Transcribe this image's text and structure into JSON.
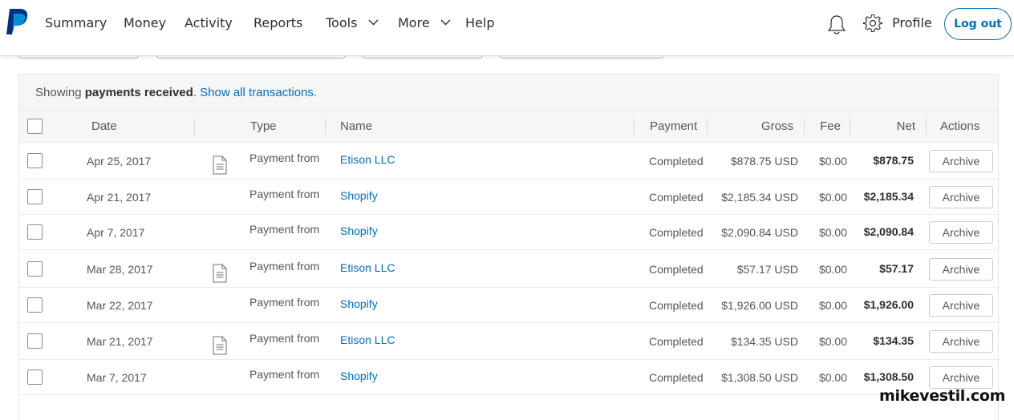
{
  "nav": {
    "items": [
      "Summary",
      "Money",
      "Activity",
      "Reports",
      "Tools",
      "More",
      "Help"
    ],
    "profile": "Profile",
    "logout": "Log out"
  },
  "banner": {
    "prefix": "Showing ",
    "bold": "payments received",
    "dot": ". ",
    "link": "Show all transactions."
  },
  "table": {
    "headers": {
      "date": "Date",
      "type": "Type",
      "name": "Name",
      "payment": "Payment",
      "gross": "Gross",
      "fee": "Fee",
      "net": "Net",
      "actions": "Actions"
    },
    "archive_label": "Archive",
    "rows": [
      {
        "date": "Apr 25, 2017",
        "doc": true,
        "type": "Payment from",
        "name": "Etison LLC",
        "payment": "Completed",
        "gross": "$878.75 USD",
        "fee": "$0.00",
        "net": "$878.75"
      },
      {
        "date": "Apr 21, 2017",
        "doc": false,
        "type": "Payment from",
        "name": "Shopify",
        "payment": "Completed",
        "gross": "$2,185.34 USD",
        "fee": "$0.00",
        "net": "$2,185.34"
      },
      {
        "date": "Apr 7, 2017",
        "doc": false,
        "type": "Payment from",
        "name": "Shopify",
        "payment": "Completed",
        "gross": "$2,090.84 USD",
        "fee": "$0.00",
        "net": "$2,090.84"
      },
      {
        "date": "Mar 28, 2017",
        "doc": true,
        "type": "Payment from",
        "name": "Etison LLC",
        "payment": "Completed",
        "gross": "$57.17 USD",
        "fee": "$0.00",
        "net": "$57.17"
      },
      {
        "date": "Mar 22, 2017",
        "doc": false,
        "type": "Payment from",
        "name": "Shopify",
        "payment": "Completed",
        "gross": "$1,926.00 USD",
        "fee": "$0.00",
        "net": "$1,926.00"
      },
      {
        "date": "Mar 21, 2017",
        "doc": true,
        "type": "Payment from",
        "name": "Etison LLC",
        "payment": "Completed",
        "gross": "$134.35 USD",
        "fee": "$0.00",
        "net": "$134.35"
      },
      {
        "date": "Mar 7, 2017",
        "doc": false,
        "type": "Payment from",
        "name": "Shopify",
        "payment": "Completed",
        "gross": "$1,308.50 USD",
        "fee": "$0.00",
        "net": "$1,308.50"
      }
    ]
  },
  "watermark": "mikevestil.com",
  "colors": {
    "brand_blue": "#0070ba",
    "logo_dark": "#003087",
    "logo_light": "#009cde"
  }
}
